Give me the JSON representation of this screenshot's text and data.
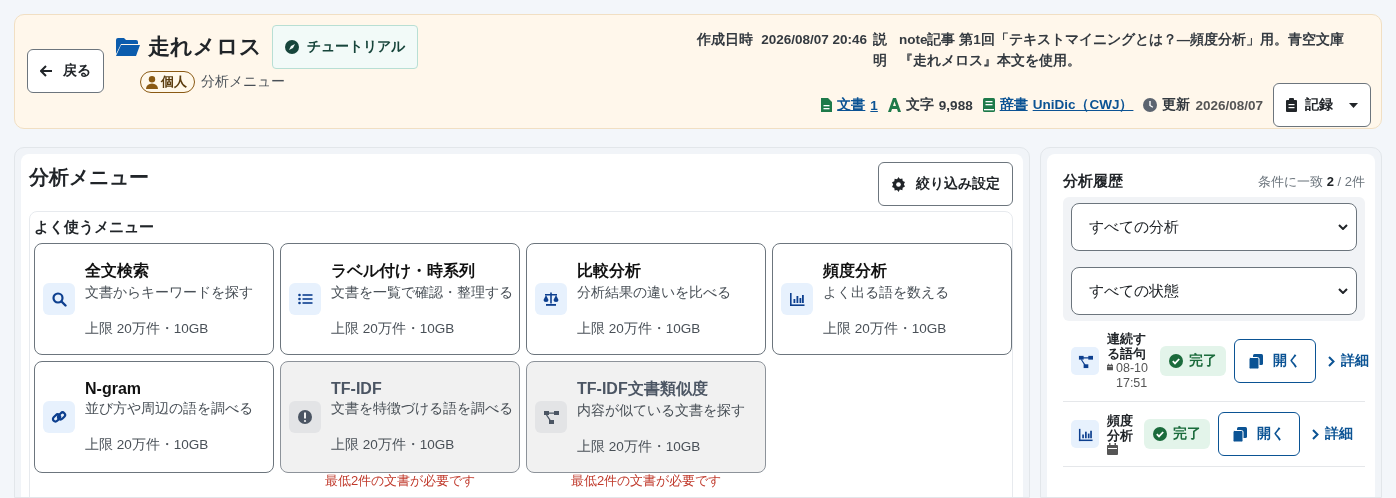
{
  "header": {
    "back_label": "戻る",
    "title": "走れメロス",
    "tutorial_label": "チュートリアル",
    "owner_badge": "個人",
    "breadcrumb": "分析メニュー",
    "created_label": "作成日時",
    "created_value": "2026/08/07 20:46",
    "description_label": "説明",
    "description": "note記事 第1回「テキストマイニングとは？―頻度分析」用。青空文庫『走れメロス』本文を使用。",
    "stats": [
      {
        "kind": "docs",
        "label": "文書",
        "value": "1",
        "link": true
      },
      {
        "kind": "chars",
        "label": "文字",
        "value": "9,988",
        "link": false
      },
      {
        "kind": "dict",
        "label": "辞書",
        "value": "UniDic（CWJ）",
        "link": true
      },
      {
        "kind": "updated",
        "label": "更新",
        "value": "2026/08/07",
        "link": false
      }
    ],
    "record_label": "記録"
  },
  "menu": {
    "title": "分析メニュー",
    "filter_button": "絞り込み設定",
    "section_title": "よく使うメニュー",
    "cards": [
      {
        "kind": "search",
        "title": "全文検索",
        "description": "文書からキーワードを探す",
        "limit": "上限 20万件・10GB",
        "disabled": false
      },
      {
        "kind": "list",
        "title": "ラベル付け・時系列",
        "description": "文書を一覧で確認・整理する",
        "limit": "上限 20万件・10GB",
        "disabled": false
      },
      {
        "kind": "scale",
        "title": "比較分析",
        "description": "分析結果の違いを比べる",
        "limit": "上限 20万件・10GB",
        "disabled": false
      },
      {
        "kind": "chart",
        "title": "頻度分析",
        "description": "よく出る語を数える",
        "limit": "上限 20万件・10GB",
        "disabled": false
      },
      {
        "kind": "link",
        "title": "N-gram",
        "description": "並び方や周辺の語を調べる",
        "limit": "上限 20万件・10GB",
        "disabled": false
      },
      {
        "kind": "alert",
        "title": "TF-IDF",
        "description": "文書を特徴づける語を調べる",
        "limit": "上限 20万件・10GB",
        "disabled": true,
        "note": "最低2件の文書が必要です"
      },
      {
        "kind": "nodes",
        "title": "TF-IDF文書類似度",
        "description": "内容が似ている文書を探す",
        "limit": "上限 20万件・10GB",
        "disabled": true,
        "note": "最低2件の文書が必要です"
      }
    ]
  },
  "history": {
    "title": "分析履歴",
    "count_prefix": "条件に一致",
    "count_match": "2",
    "count_total": "/ 2件",
    "filters": [
      {
        "value": "すべての分析"
      },
      {
        "value": "すべての状態"
      }
    ],
    "items": [
      {
        "kind": "nodes",
        "title": "連続する語句",
        "date": "08-10 17:51",
        "status": "完了",
        "open_label": "開く",
        "detail_label": "詳細"
      },
      {
        "kind": "chart",
        "title": "頻度分析",
        "status": "完了",
        "open_label": "開く",
        "detail_label": "詳細"
      }
    ]
  }
}
